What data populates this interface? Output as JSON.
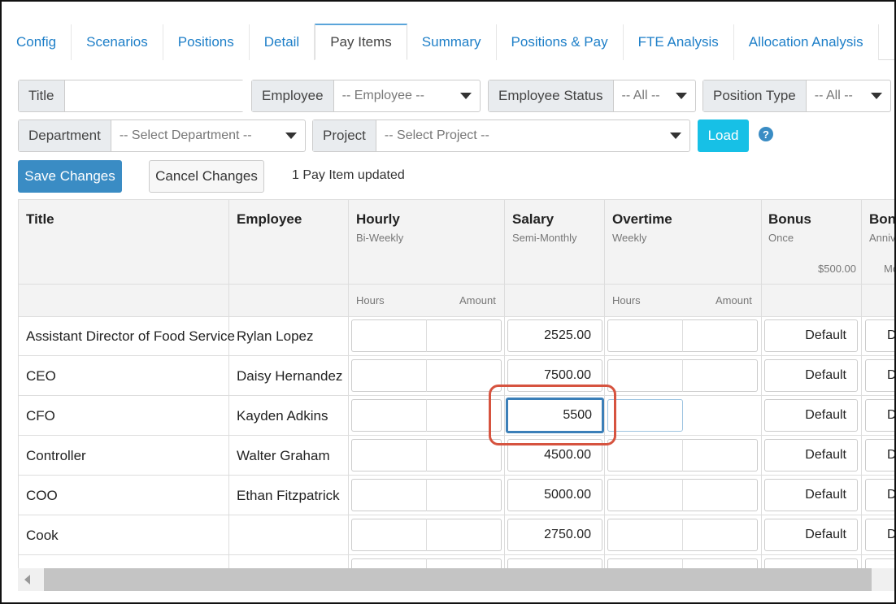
{
  "tabs": [
    "Config",
    "Scenarios",
    "Positions",
    "Detail",
    "Pay Items",
    "Summary",
    "Positions & Pay",
    "FTE Analysis",
    "Allocation Analysis"
  ],
  "active_tab": "Pay Items",
  "filters": {
    "title_label": "Title",
    "title_value": "",
    "employee_label": "Employee",
    "employee_value": "-- Employee --",
    "employee_status_label": "Employee Status",
    "employee_status_value": "-- All --",
    "position_type_label": "Position Type",
    "position_type_value": "-- All --",
    "department_label": "Department",
    "department_value": "-- Select Department --",
    "project_label": "Project",
    "project_value": "-- Select Project --",
    "load_label": "Load",
    "help_icon": "?"
  },
  "actions": {
    "save_label": "Save Changes",
    "cancel_label": "Cancel Changes",
    "status": "1 Pay Item updated"
  },
  "table": {
    "columns": {
      "title": "Title",
      "employee": "Employee",
      "hourly": {
        "label": "Hourly",
        "sub": "Bi-Weekly",
        "hours": "Hours",
        "amount": "Amount"
      },
      "salary": {
        "label": "Salary",
        "sub": "Semi-Monthly"
      },
      "overtime": {
        "label": "Overtime",
        "sub": "Weekly",
        "hours": "Hours",
        "amount": "Amount"
      },
      "bonus": {
        "label": "Bonus",
        "sub": "Once",
        "default_amount": "$500.00"
      },
      "bonus2": {
        "label": "Bonu",
        "sub": "Anniv",
        "sub2": "Mo"
      }
    },
    "rows": [
      {
        "title": "Assistant Director of Food Service",
        "employee": "Rylan Lopez",
        "salary": "2525.00",
        "bonus": "Default",
        "bonus2": "D"
      },
      {
        "title": "CEO",
        "employee": "Daisy Hernandez",
        "salary": "7500.00",
        "bonus": "Default",
        "bonus2": "D"
      },
      {
        "title": "CFO",
        "employee": "Kayden Adkins",
        "salary": "5500",
        "bonus": "Default",
        "bonus2": "D"
      },
      {
        "title": "Controller",
        "employee": "Walter Graham",
        "salary": "4500.00",
        "bonus": "Default",
        "bonus2": "D"
      },
      {
        "title": "COO",
        "employee": "Ethan Fitzpatrick",
        "salary": "5000.00",
        "bonus": "Default",
        "bonus2": "D"
      },
      {
        "title": "Cook",
        "employee": "",
        "salary": "2750.00",
        "bonus": "Default",
        "bonus2": "D"
      }
    ]
  },
  "colors": {
    "accent": "#1e7fc8",
    "load": "#17c0e6",
    "save": "#3a8cc4",
    "highlight": "#d6533f"
  }
}
